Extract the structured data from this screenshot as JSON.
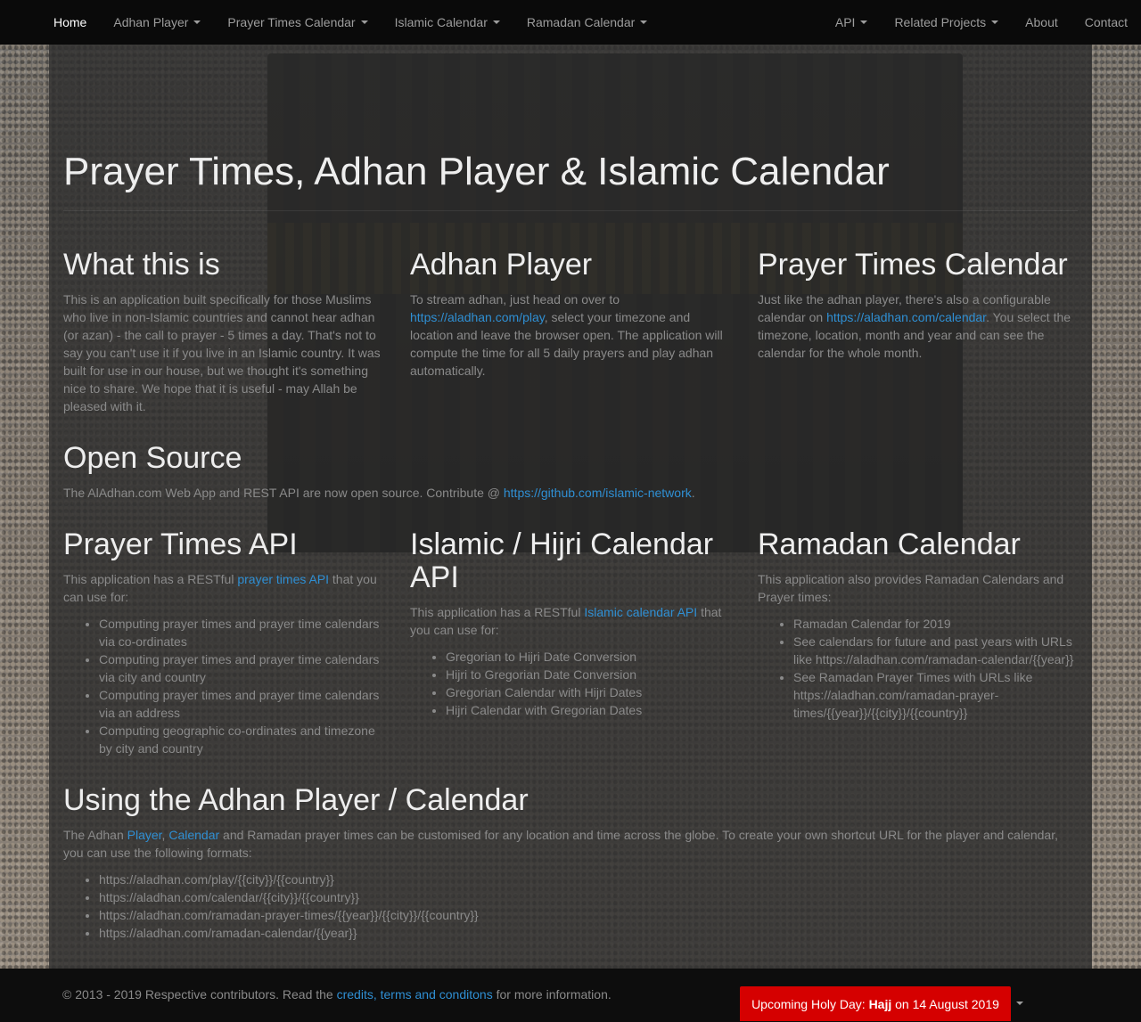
{
  "nav": {
    "left": [
      {
        "label": "Home",
        "caret": false
      },
      {
        "label": "Adhan Player",
        "caret": true
      },
      {
        "label": "Prayer Times Calendar",
        "caret": true
      },
      {
        "label": "Islamic Calendar",
        "caret": true
      },
      {
        "label": "Ramadan Calendar",
        "caret": true
      }
    ],
    "right": [
      {
        "label": "API",
        "caret": true
      },
      {
        "label": "Related Projects",
        "caret": true
      },
      {
        "label": "About",
        "caret": false
      },
      {
        "label": "Contact",
        "caret": false
      }
    ]
  },
  "page_title": "Prayer Times, Adhan Player & Islamic Calendar",
  "what": {
    "heading": "What this is",
    "text": "This is an application built specifically for those Muslims who live in non-Islamic countries and cannot hear adhan (or azan) - the call to prayer - 5 times a day. That's not to say you can't use it if you live in an Islamic country. It was built for use in our house, but we thought it's something nice to share. We hope that it is useful - may Allah be pleased with it."
  },
  "adhan": {
    "heading": "Adhan Player",
    "text_before": "To stream adhan, just head on over to",
    "link": "https://aladhan.com/play",
    "text_after": ", select your timezone and location and leave the browser open. The application will compute the time for all 5 daily prayers and play adhan automatically."
  },
  "calendar": {
    "heading": "Prayer Times Calendar",
    "text_before": "Just like the adhan player, there's also a configurable calendar on",
    "link": "https://aladhan.com/calendar",
    "text_after": ". You select the timezone, location, month and year and can see the calendar for the whole month."
  },
  "open_source": {
    "heading": "Open Source",
    "text_before": "The AlAdhan.com Web App and REST API are now open source. Contribute @",
    "link": "https://github.com/islamic-network",
    "text_after": "."
  },
  "prayer_api": {
    "heading": "Prayer Times API",
    "text_before": "This application has a RESTful",
    "link": "prayer times API",
    "text_after": "that you can use for:",
    "items": [
      "Computing prayer times and prayer time calendars via co-ordinates",
      "Computing prayer times and prayer time calendars via city and country",
      "Computing prayer times and prayer time calendars via an address",
      "Computing geographic co-ordinates and timezone by city and country"
    ]
  },
  "hijri_api": {
    "heading": "Islamic / Hijri Calendar API",
    "text_before": "This application has a RESTful",
    "link": "Islamic calendar API",
    "text_after": "that you can use for:",
    "items": [
      {
        "text": "Gregorian to Hijri Date Conversion",
        "link": false
      },
      {
        "text": "Hijri to Gregorian Date Conversion",
        "link": false
      },
      {
        "text": "Gregorian Calendar with Hijri Dates",
        "link": true
      },
      {
        "text": "Hijri Calendar with Gregorian Dates",
        "link": true
      }
    ]
  },
  "ramadan": {
    "heading": "Ramadan Calendar",
    "text": "This application also provides Ramadan Calendars and Prayer times:",
    "items": [
      {
        "text": "Ramadan Calendar for 2019",
        "link": true
      },
      {
        "text": "See calendars for future and past years with URLs like https://aladhan.com/ramadan-calendar/{{year}}",
        "link": false
      },
      {
        "text": "See Ramadan Prayer Times with URLs like https://aladhan.com/ramadan-prayer-times/{{year}}/{{city}}/{{country}}",
        "link": false
      }
    ]
  },
  "using": {
    "heading": "Using the Adhan Player / Calendar",
    "text_before": "The Adhan",
    "link1": "Player",
    "sep": ",",
    "link2": "Calendar",
    "text_after": "and Ramadan prayer times can be customised for any location and time across the globe. To create your own shortcut URL for the player and calendar, you can use the following formats:",
    "items": [
      "https://aladhan.com/play/{{city}}/{{country}}",
      "https://aladhan.com/calendar/{{city}}/{{country}}",
      "https://aladhan.com/ramadan-prayer-times/{{year}}/{{city}}/{{country}}",
      "https://aladhan.com/ramadan-calendar/{{year}}"
    ]
  },
  "footer": {
    "text_before": "© 2013 - 2019 Respective contributors. Read the",
    "link": "credits, terms and conditons",
    "text_after": "for more information.",
    "holy_day_prefix": "Upcoming Holy Day:",
    "holy_day_name": "Hajj",
    "holy_day_suffix": "on 14 August 2019"
  },
  "colors": {
    "link": "#2f8fd3",
    "holy_day_button": "#d50000",
    "navbar": "#0a0a0a"
  }
}
